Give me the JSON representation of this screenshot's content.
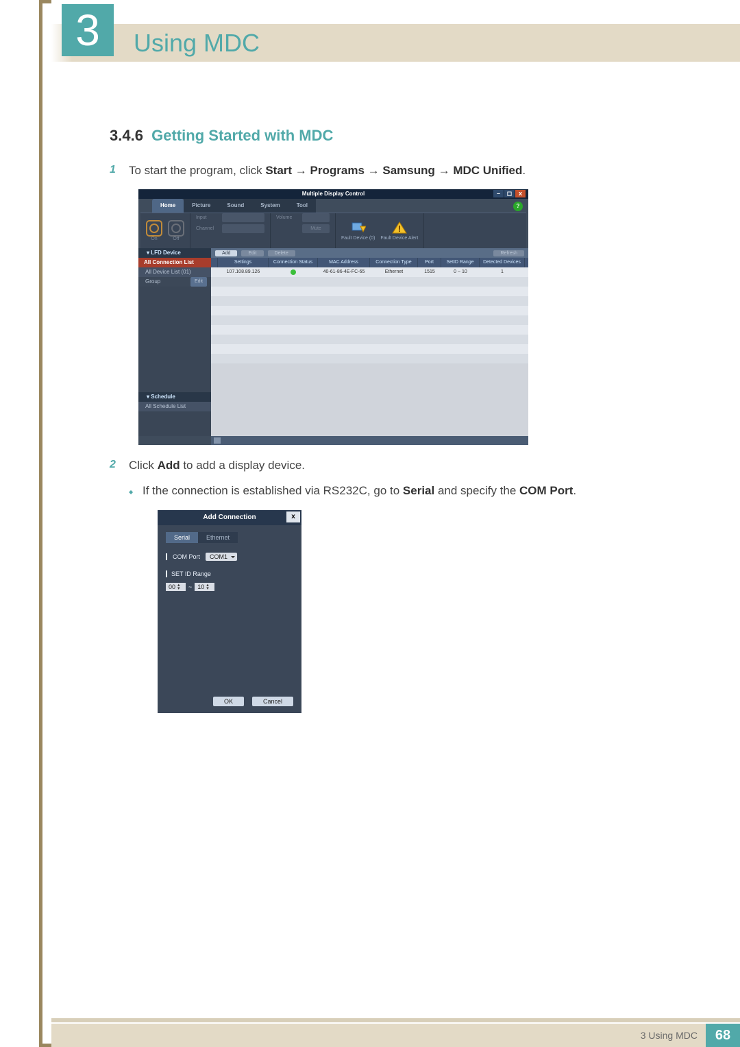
{
  "chapter": {
    "num": "3",
    "title": "Using MDC"
  },
  "section": {
    "num": "3.4.6",
    "title": "Getting Started with MDC"
  },
  "step1": {
    "n": "1",
    "t_pre": "To start the program, click ",
    "b1": "Start",
    "arr1": " → ",
    "b2": "Programs",
    "arr2": " → ",
    "b3": "Samsung",
    "arr3": " → ",
    "b4": "MDC Unified",
    "t_post": "."
  },
  "step2": {
    "n": "2",
    "t_pre": "Click ",
    "b1": "Add",
    "t_post": " to add a display device."
  },
  "sub1": {
    "a": "If the connection is established via RS232C, go to ",
    "b1": "Serial",
    "mid": " and specify the ",
    "b2": "COM Port",
    "post": "."
  },
  "shot1": {
    "title": "Multiple Display Control",
    "win": [
      "–",
      "◻",
      "x"
    ],
    "tabs": [
      "Home",
      "Picture",
      "Sound",
      "System",
      "Tool"
    ],
    "ribbon": {
      "on": "On",
      "off": "Off",
      "input": "Input",
      "channel": "Channel",
      "volume": "Volume",
      "mute": "Mute",
      "fd0": "Fault Device (0)",
      "fda": "Fault Device Alert"
    },
    "help": "?",
    "side": {
      "lfd": "▾ LFD Device",
      "allconn": "All Connection List",
      "alldev": "All Device List (01)",
      "group": "Group",
      "edit": "Edit",
      "sched": "▾ Schedule",
      "allsched": "All Schedule List"
    },
    "bar": {
      "add": "Add",
      "edit": "Edit",
      "delete": "Delete",
      "refresh": "Refresh"
    },
    "th": [
      "",
      "Settings",
      "Connection Status",
      "MAC Address",
      "Connection Type",
      "Port",
      "SetID Range",
      "Detected Devices"
    ],
    "row": [
      "",
      "107.108.89.126",
      "",
      "40-61-86-4E-FC-65",
      "Ethernet",
      "1515",
      "0 ~ 10",
      "1"
    ]
  },
  "shot2": {
    "title": "Add Connection",
    "close": "x",
    "tabs": [
      "Serial",
      "Ethernet"
    ],
    "com_l": "COM Port",
    "com_v": "COM1",
    "set_l": "SET ID Range",
    "s_from": "00",
    "tilde": "~",
    "s_to": "10",
    "ok": "OK",
    "cancel": "Cancel"
  },
  "footer": {
    "left": "3 Using MDC",
    "page": "68"
  }
}
